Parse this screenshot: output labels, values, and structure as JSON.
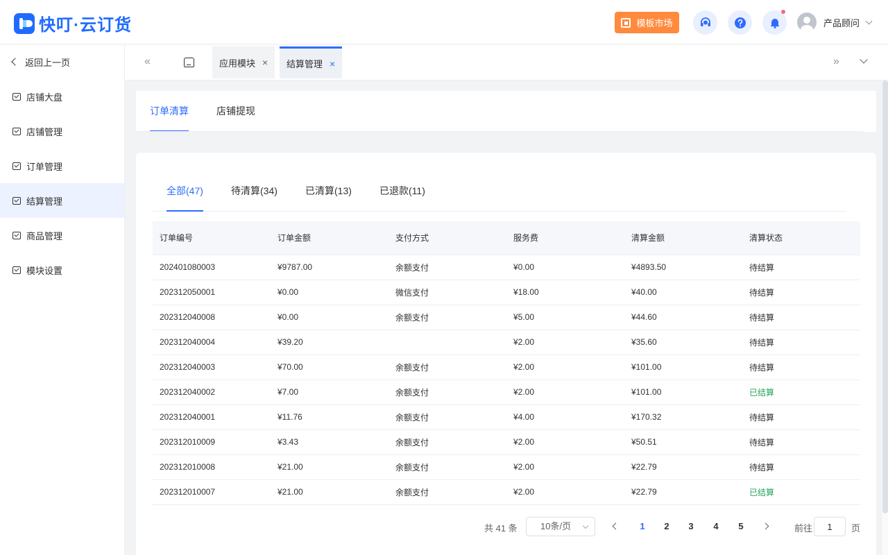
{
  "header": {
    "logo_text": "快叮·云订货",
    "template_button": "模板市场",
    "user_name": "产品顾问",
    "colors": {
      "brand": "#1f6bff",
      "template": "#ff8a3d",
      "notify_dot": "#f56c6c"
    }
  },
  "sidebar": {
    "back_label": "返回上一页",
    "items": [
      {
        "label": "店铺大盘"
      },
      {
        "label": "店铺管理"
      },
      {
        "label": "订单管理"
      },
      {
        "label": "结算管理"
      },
      {
        "label": "商品管理"
      },
      {
        "label": "模块设置"
      }
    ],
    "active_index": 3
  },
  "tabsbar": {
    "tabs": [
      {
        "label": "应用模块",
        "close": "×"
      },
      {
        "label": "结算管理",
        "close": "×"
      }
    ]
  },
  "top_tabs": [
    "订单清算",
    "店铺提现"
  ],
  "sub_tabs": [
    "全部(47)",
    "待清算(34)",
    "已清算(13)",
    "已退款(11)"
  ],
  "table": {
    "columns": [
      "订单编号",
      "订单金额",
      "支付方式",
      "服务费",
      "清算金额",
      "清算状态"
    ],
    "rows": [
      [
        "202401080003",
        "¥9787.00",
        "余额支付",
        "¥0.00",
        "¥4893.50",
        "待结算"
      ],
      [
        "202312050001",
        "¥0.00",
        "微信支付",
        "¥18.00",
        "¥40.00",
        "待结算"
      ],
      [
        "202312040008",
        "¥0.00",
        "余额支付",
        "¥5.00",
        "¥44.60",
        "待结算"
      ],
      [
        "202312040004",
        "¥39.20",
        "",
        "¥2.00",
        "¥35.60",
        "待结算"
      ],
      [
        "202312040003",
        "¥70.00",
        "余额支付",
        "¥2.00",
        "¥101.00",
        "待结算"
      ],
      [
        "202312040002",
        "¥7.00",
        "余额支付",
        "¥2.00",
        "¥101.00",
        "已结算"
      ],
      [
        "202312040001",
        "¥11.76",
        "余额支付",
        "¥4.00",
        "¥170.32",
        "待结算"
      ],
      [
        "202312010009",
        "¥3.43",
        "余额支付",
        "¥2.00",
        "¥50.51",
        "待结算"
      ],
      [
        "202312010008",
        "¥21.00",
        "余额支付",
        "¥2.00",
        "¥22.79",
        "待结算"
      ],
      [
        "202312010007",
        "¥21.00",
        "余额支付",
        "¥2.00",
        "¥22.79",
        "已结算"
      ]
    ],
    "status_colors": {
      "pending": "#303133",
      "done": "#27a35a"
    }
  },
  "pagination": {
    "total_text": "共 41 条",
    "page_size": "10条/页",
    "pages": [
      "1",
      "2",
      "3",
      "4",
      "5"
    ],
    "current": "1",
    "goto_label": "前往",
    "goto_value": "1",
    "goto_unit": "页"
  }
}
